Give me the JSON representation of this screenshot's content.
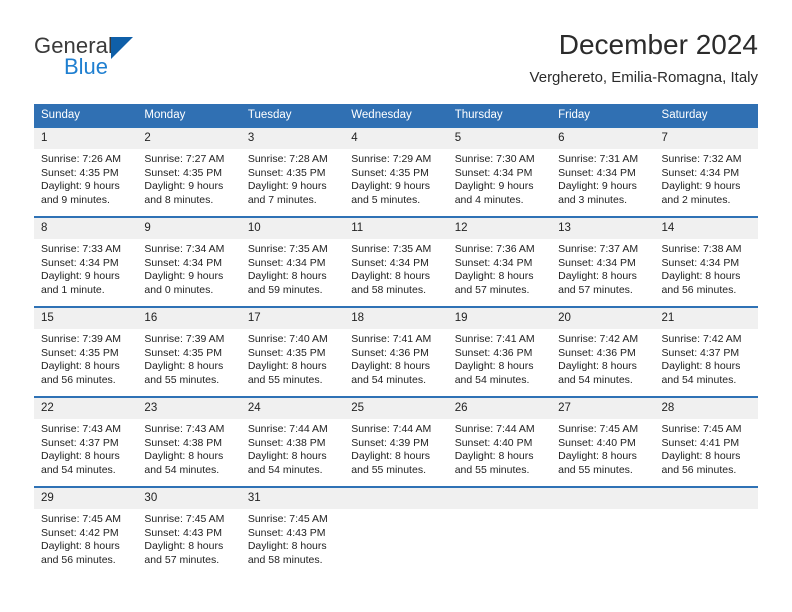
{
  "brand": {
    "name_top": "General",
    "name_bottom": "Blue",
    "mark": "triangle-logo",
    "color_top": "#3a3a3a",
    "color_bottom": "#1f7fd0",
    "color_mark": "#0f5fa8"
  },
  "header": {
    "title": "December 2024",
    "subtitle": "Verghereto, Emilia-Romagna, Italy"
  },
  "theme": {
    "header_blue": "#3070b3",
    "row_rule_blue": "#2f72b5",
    "daynum_background": "#f0f0f0",
    "cell_background": "#ffffff",
    "text": "#222222"
  },
  "calendar": {
    "weekday_headers": [
      "Sunday",
      "Monday",
      "Tuesday",
      "Wednesday",
      "Thursday",
      "Friday",
      "Saturday"
    ],
    "weeks": [
      [
        {
          "day": "1",
          "sunrise": "Sunrise: 7:26 AM",
          "sunset": "Sunset: 4:35 PM",
          "daylight_1": "Daylight: 9 hours",
          "daylight_2": "and 9 minutes."
        },
        {
          "day": "2",
          "sunrise": "Sunrise: 7:27 AM",
          "sunset": "Sunset: 4:35 PM",
          "daylight_1": "Daylight: 9 hours",
          "daylight_2": "and 8 minutes."
        },
        {
          "day": "3",
          "sunrise": "Sunrise: 7:28 AM",
          "sunset": "Sunset: 4:35 PM",
          "daylight_1": "Daylight: 9 hours",
          "daylight_2": "and 7 minutes."
        },
        {
          "day": "4",
          "sunrise": "Sunrise: 7:29 AM",
          "sunset": "Sunset: 4:35 PM",
          "daylight_1": "Daylight: 9 hours",
          "daylight_2": "and 5 minutes."
        },
        {
          "day": "5",
          "sunrise": "Sunrise: 7:30 AM",
          "sunset": "Sunset: 4:34 PM",
          "daylight_1": "Daylight: 9 hours",
          "daylight_2": "and 4 minutes."
        },
        {
          "day": "6",
          "sunrise": "Sunrise: 7:31 AM",
          "sunset": "Sunset: 4:34 PM",
          "daylight_1": "Daylight: 9 hours",
          "daylight_2": "and 3 minutes."
        },
        {
          "day": "7",
          "sunrise": "Sunrise: 7:32 AM",
          "sunset": "Sunset: 4:34 PM",
          "daylight_1": "Daylight: 9 hours",
          "daylight_2": "and 2 minutes."
        }
      ],
      [
        {
          "day": "8",
          "sunrise": "Sunrise: 7:33 AM",
          "sunset": "Sunset: 4:34 PM",
          "daylight_1": "Daylight: 9 hours",
          "daylight_2": "and 1 minute."
        },
        {
          "day": "9",
          "sunrise": "Sunrise: 7:34 AM",
          "sunset": "Sunset: 4:34 PM",
          "daylight_1": "Daylight: 9 hours",
          "daylight_2": "and 0 minutes."
        },
        {
          "day": "10",
          "sunrise": "Sunrise: 7:35 AM",
          "sunset": "Sunset: 4:34 PM",
          "daylight_1": "Daylight: 8 hours",
          "daylight_2": "and 59 minutes."
        },
        {
          "day": "11",
          "sunrise": "Sunrise: 7:35 AM",
          "sunset": "Sunset: 4:34 PM",
          "daylight_1": "Daylight: 8 hours",
          "daylight_2": "and 58 minutes."
        },
        {
          "day": "12",
          "sunrise": "Sunrise: 7:36 AM",
          "sunset": "Sunset: 4:34 PM",
          "daylight_1": "Daylight: 8 hours",
          "daylight_2": "and 57 minutes."
        },
        {
          "day": "13",
          "sunrise": "Sunrise: 7:37 AM",
          "sunset": "Sunset: 4:34 PM",
          "daylight_1": "Daylight: 8 hours",
          "daylight_2": "and 57 minutes."
        },
        {
          "day": "14",
          "sunrise": "Sunrise: 7:38 AM",
          "sunset": "Sunset: 4:34 PM",
          "daylight_1": "Daylight: 8 hours",
          "daylight_2": "and 56 minutes."
        }
      ],
      [
        {
          "day": "15",
          "sunrise": "Sunrise: 7:39 AM",
          "sunset": "Sunset: 4:35 PM",
          "daylight_1": "Daylight: 8 hours",
          "daylight_2": "and 56 minutes."
        },
        {
          "day": "16",
          "sunrise": "Sunrise: 7:39 AM",
          "sunset": "Sunset: 4:35 PM",
          "daylight_1": "Daylight: 8 hours",
          "daylight_2": "and 55 minutes."
        },
        {
          "day": "17",
          "sunrise": "Sunrise: 7:40 AM",
          "sunset": "Sunset: 4:35 PM",
          "daylight_1": "Daylight: 8 hours",
          "daylight_2": "and 55 minutes."
        },
        {
          "day": "18",
          "sunrise": "Sunrise: 7:41 AM",
          "sunset": "Sunset: 4:36 PM",
          "daylight_1": "Daylight: 8 hours",
          "daylight_2": "and 54 minutes."
        },
        {
          "day": "19",
          "sunrise": "Sunrise: 7:41 AM",
          "sunset": "Sunset: 4:36 PM",
          "daylight_1": "Daylight: 8 hours",
          "daylight_2": "and 54 minutes."
        },
        {
          "day": "20",
          "sunrise": "Sunrise: 7:42 AM",
          "sunset": "Sunset: 4:36 PM",
          "daylight_1": "Daylight: 8 hours",
          "daylight_2": "and 54 minutes."
        },
        {
          "day": "21",
          "sunrise": "Sunrise: 7:42 AM",
          "sunset": "Sunset: 4:37 PM",
          "daylight_1": "Daylight: 8 hours",
          "daylight_2": "and 54 minutes."
        }
      ],
      [
        {
          "day": "22",
          "sunrise": "Sunrise: 7:43 AM",
          "sunset": "Sunset: 4:37 PM",
          "daylight_1": "Daylight: 8 hours",
          "daylight_2": "and 54 minutes."
        },
        {
          "day": "23",
          "sunrise": "Sunrise: 7:43 AM",
          "sunset": "Sunset: 4:38 PM",
          "daylight_1": "Daylight: 8 hours",
          "daylight_2": "and 54 minutes."
        },
        {
          "day": "24",
          "sunrise": "Sunrise: 7:44 AM",
          "sunset": "Sunset: 4:38 PM",
          "daylight_1": "Daylight: 8 hours",
          "daylight_2": "and 54 minutes."
        },
        {
          "day": "25",
          "sunrise": "Sunrise: 7:44 AM",
          "sunset": "Sunset: 4:39 PM",
          "daylight_1": "Daylight: 8 hours",
          "daylight_2": "and 55 minutes."
        },
        {
          "day": "26",
          "sunrise": "Sunrise: 7:44 AM",
          "sunset": "Sunset: 4:40 PM",
          "daylight_1": "Daylight: 8 hours",
          "daylight_2": "and 55 minutes."
        },
        {
          "day": "27",
          "sunrise": "Sunrise: 7:45 AM",
          "sunset": "Sunset: 4:40 PM",
          "daylight_1": "Daylight: 8 hours",
          "daylight_2": "and 55 minutes."
        },
        {
          "day": "28",
          "sunrise": "Sunrise: 7:45 AM",
          "sunset": "Sunset: 4:41 PM",
          "daylight_1": "Daylight: 8 hours",
          "daylight_2": "and 56 minutes."
        }
      ],
      [
        {
          "day": "29",
          "sunrise": "Sunrise: 7:45 AM",
          "sunset": "Sunset: 4:42 PM",
          "daylight_1": "Daylight: 8 hours",
          "daylight_2": "and 56 minutes."
        },
        {
          "day": "30",
          "sunrise": "Sunrise: 7:45 AM",
          "sunset": "Sunset: 4:43 PM",
          "daylight_1": "Daylight: 8 hours",
          "daylight_2": "and 57 minutes."
        },
        {
          "day": "31",
          "sunrise": "Sunrise: 7:45 AM",
          "sunset": "Sunset: 4:43 PM",
          "daylight_1": "Daylight: 8 hours",
          "daylight_2": "and 58 minutes."
        },
        {
          "day": "",
          "sunrise": "",
          "sunset": "",
          "daylight_1": "",
          "daylight_2": ""
        },
        {
          "day": "",
          "sunrise": "",
          "sunset": "",
          "daylight_1": "",
          "daylight_2": ""
        },
        {
          "day": "",
          "sunrise": "",
          "sunset": "",
          "daylight_1": "",
          "daylight_2": ""
        },
        {
          "day": "",
          "sunrise": "",
          "sunset": "",
          "daylight_1": "",
          "daylight_2": ""
        }
      ]
    ]
  }
}
